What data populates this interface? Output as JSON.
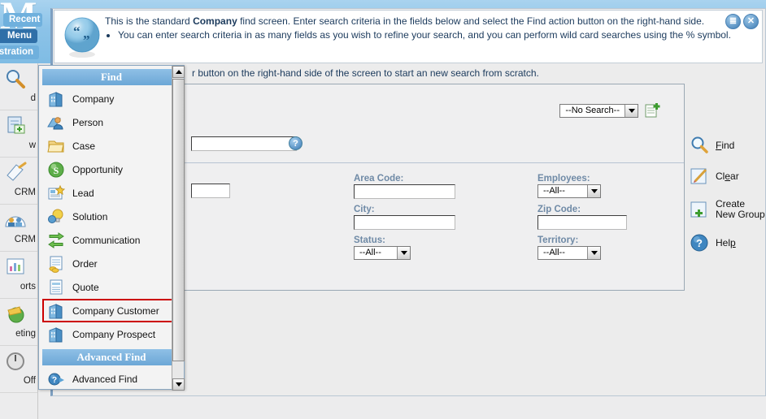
{
  "brand": {
    "text": "M"
  },
  "nav_tabs": [
    {
      "label": "Recent",
      "selected": false
    },
    {
      "label": "Menu",
      "selected": true
    },
    {
      "label": "stration",
      "selected": false
    }
  ],
  "rail": {
    "items": [
      {
        "label": "d",
        "icon": "find-magnifier-icon"
      },
      {
        "label": "w",
        "icon": "new-document-icon"
      },
      {
        "label": "CRM",
        "icon": "my-crm-icon"
      },
      {
        "label": "CRM",
        "icon": "team-crm-icon"
      },
      {
        "label": "orts",
        "icon": "reports-chart-icon"
      },
      {
        "label": "eting",
        "icon": "marketing-icon"
      },
      {
        "label": "Off",
        "icon": "log-off-icon"
      }
    ]
  },
  "help": {
    "icon": "speech-bubble-icon",
    "line1_pre": "This is the standard ",
    "line1_bold": "Company",
    "line1_post": " find screen. Enter search criteria in the fields below and select the Find action button on the right-hand side.",
    "bullet1": "You can enter search criteria in as many fields as you wish to refine your search, and you can perform wild card searches using the % symbol.",
    "line3_clipped": "r button on the right-hand side of the screen to start an new search from scratch.",
    "buttons": [
      {
        "name": "list-options-icon",
        "glyph": "≣"
      },
      {
        "name": "close-icon",
        "glyph": "✕"
      }
    ]
  },
  "search_panel": {
    "saved_search": {
      "value": "--No Search--"
    },
    "new_group_icon": "new-group-icon",
    "help_icon_label": "?",
    "fields": [
      {
        "name": "area-code",
        "label": "Area Code:",
        "type": "text",
        "value": ""
      },
      {
        "name": "employees",
        "label": "Employees:",
        "type": "select",
        "value": "--All--"
      },
      {
        "name": "city",
        "label": "City:",
        "type": "text",
        "value": ""
      },
      {
        "name": "zip-code",
        "label": "Zip Code:",
        "type": "text",
        "value": ""
      },
      {
        "name": "status",
        "label": "Status:",
        "type": "select",
        "value": "--All--"
      },
      {
        "name": "territory",
        "label": "Territory:",
        "type": "select",
        "value": "--All--"
      }
    ]
  },
  "actions": [
    {
      "label": "Find",
      "underline_index": 0,
      "icon": "magnifier-icon"
    },
    {
      "label": "Clear",
      "underline_index": 2,
      "icon": "pencil-edit-icon"
    },
    {
      "label": "Create New Group",
      "line1": "Create",
      "line2": "New Group",
      "icon": "create-group-icon"
    },
    {
      "label": "Help",
      "underline_index": 3,
      "icon": "question-help-icon"
    }
  ],
  "find_menu": {
    "header": "Find",
    "items": [
      {
        "label": "Company",
        "icon": "company-building-icon",
        "highlighted": false
      },
      {
        "label": "Person",
        "icon": "person-icon",
        "highlighted": false
      },
      {
        "label": "Case",
        "icon": "case-folder-icon",
        "highlighted": false
      },
      {
        "label": "Opportunity",
        "icon": "opportunity-icon",
        "highlighted": false
      },
      {
        "label": "Lead",
        "icon": "lead-icon",
        "highlighted": false
      },
      {
        "label": "Solution",
        "icon": "solution-bulb-icon",
        "highlighted": false
      },
      {
        "label": "Communication",
        "icon": "communication-arrows-icon",
        "highlighted": false
      },
      {
        "label": "Order",
        "icon": "order-icon",
        "highlighted": false
      },
      {
        "label": "Quote",
        "icon": "quote-icon",
        "highlighted": false
      },
      {
        "label": "Company Customer",
        "icon": "company-building-icon",
        "highlighted": true
      },
      {
        "label": "Company Prospect",
        "icon": "company-building-icon",
        "highlighted": false
      }
    ],
    "section_header": "Advanced Find",
    "advanced_item": {
      "label": "Advanced Find",
      "icon": "advanced-find-icon"
    }
  },
  "colors": {
    "band_blue": "#8cc3e8",
    "tab_selected": "#2f6fa8",
    "menu_header": "#6ca7d6",
    "field_label": "#6f8aa6",
    "highlight_red": "#cc0000"
  }
}
